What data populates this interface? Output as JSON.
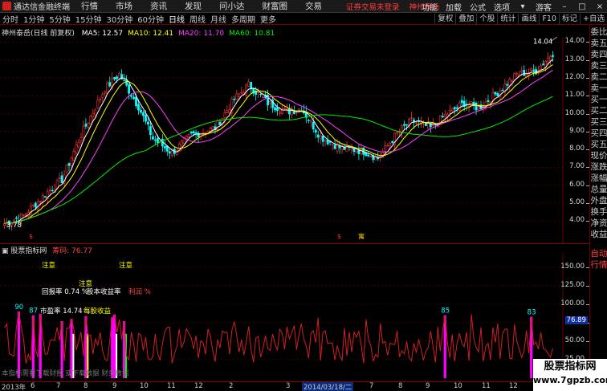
{
  "titlebar": {
    "app_name": "通达信金融终端",
    "menu": [
      "行情",
      "市场",
      "资讯",
      "发现",
      "问小达",
      "财富圈",
      "交易"
    ],
    "login_status": "证券交易未登录",
    "stock_name": "神州泰岳",
    "right_menu": [
      "功能",
      "加载",
      "公式",
      "选项"
    ],
    "user": "游客"
  },
  "toolbar": {
    "periods": [
      "分时",
      "1分钟",
      "5分钟",
      "15分钟",
      "30分钟",
      "60分钟",
      "日线",
      "周线",
      "月线",
      "多周期",
      "更多"
    ],
    "active_period": "日线",
    "right_items": [
      "复权",
      "叠加",
      "个股",
      "统计",
      "画线",
      "F10",
      "标记",
      "+自选"
    ]
  },
  "main": {
    "stock_title": "神州泰岳(日线 前复权)",
    "ma": [
      {
        "label": "MA5: 12.57",
        "color": "#ffffff"
      },
      {
        "label": "MA10: 12.41",
        "color": "#ffff00"
      },
      {
        "label": "MA20: 11.70",
        "color": "#ff40ff"
      },
      {
        "label": "MA60: 10.81",
        "color": "#00ee00"
      }
    ],
    "price_axis": [
      "14.00",
      "13.00",
      "12.00",
      "11.00",
      "10.00",
      "9.00",
      "8.00",
      "7.00",
      "6.00",
      "5.00",
      "4.00"
    ],
    "high_label": "14.04",
    "low_label": "3.78",
    "markers": [
      "$",
      "$",
      "寓"
    ]
  },
  "indicator": {
    "title": "股票指标网",
    "value_label": "筹码: 76.77",
    "axis": [
      "150.00",
      "125.00",
      "100.00",
      "75.00",
      "50.00",
      "25.00"
    ],
    "current_value": "76.89",
    "peak_labels": [
      "90",
      "87",
      "85",
      "83"
    ],
    "notes": [
      "注意",
      "注意",
      "注意"
    ],
    "texts": [
      "回报率 0.74 %",
      "股本收益率",
      "利润 %",
      "市盈率 14.74",
      "每股收益"
    ],
    "bottom_note": "本指标需要下载财报 或下载数据 财务数据"
  },
  "sidepanel": [
    "委比",
    "卖五",
    "卖四",
    "卖三",
    "卖二",
    "卖一",
    "买一",
    "买二",
    "买三",
    "买四",
    "买五",
    "现价",
    "涨跌",
    "涨幅",
    "总量",
    "外盘",
    "换手",
    "净资",
    "收益",
    "自动",
    "行情"
  ],
  "xaxis": {
    "labels": [
      "2013年",
      "6",
      "7",
      "8",
      "9",
      "10",
      "11",
      "12",
      "2",
      "3",
      "5",
      "6",
      "7",
      "8",
      "9",
      "10",
      "11",
      "12"
    ],
    "selected_date": "2014/03/18/二"
  },
  "watermark": {
    "line1": "股票指标网",
    "line2": "www.7gpzb.com"
  },
  "colors": {
    "up": "#ff3232",
    "down": "#00ffff",
    "ma5": "#ffffff",
    "ma10": "#ffff00",
    "ma20": "#ff40ff",
    "ma60": "#00ee00",
    "grid": "#6b0000"
  }
}
